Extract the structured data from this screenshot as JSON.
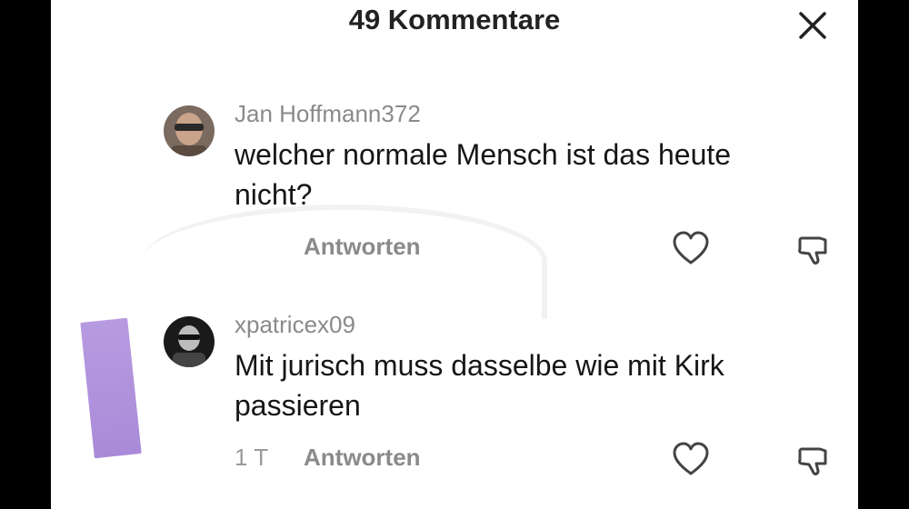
{
  "header": {
    "title": "49 Kommentare",
    "close_icon": "close-icon"
  },
  "comments": [
    {
      "username": "Jan Hoffmann372",
      "text": "welcher normale Mensch ist das heute nicht?",
      "timestamp": "",
      "reply_label": "Antworten",
      "like_icon": "heart-icon",
      "dislike_icon": "thumbs-down-icon"
    },
    {
      "username": "xpatricex09",
      "text": "Mit jurisch muss dasselbe wie mit Kirk passieren",
      "timestamp": "1 T",
      "reply_label": "Antworten",
      "like_icon": "heart-icon",
      "dislike_icon": "thumbs-down-icon"
    }
  ],
  "colors": {
    "background": "#000000",
    "panel": "#ffffff",
    "username": "#8a8a8a",
    "text": "#161616",
    "sticker": "#b79be0"
  }
}
